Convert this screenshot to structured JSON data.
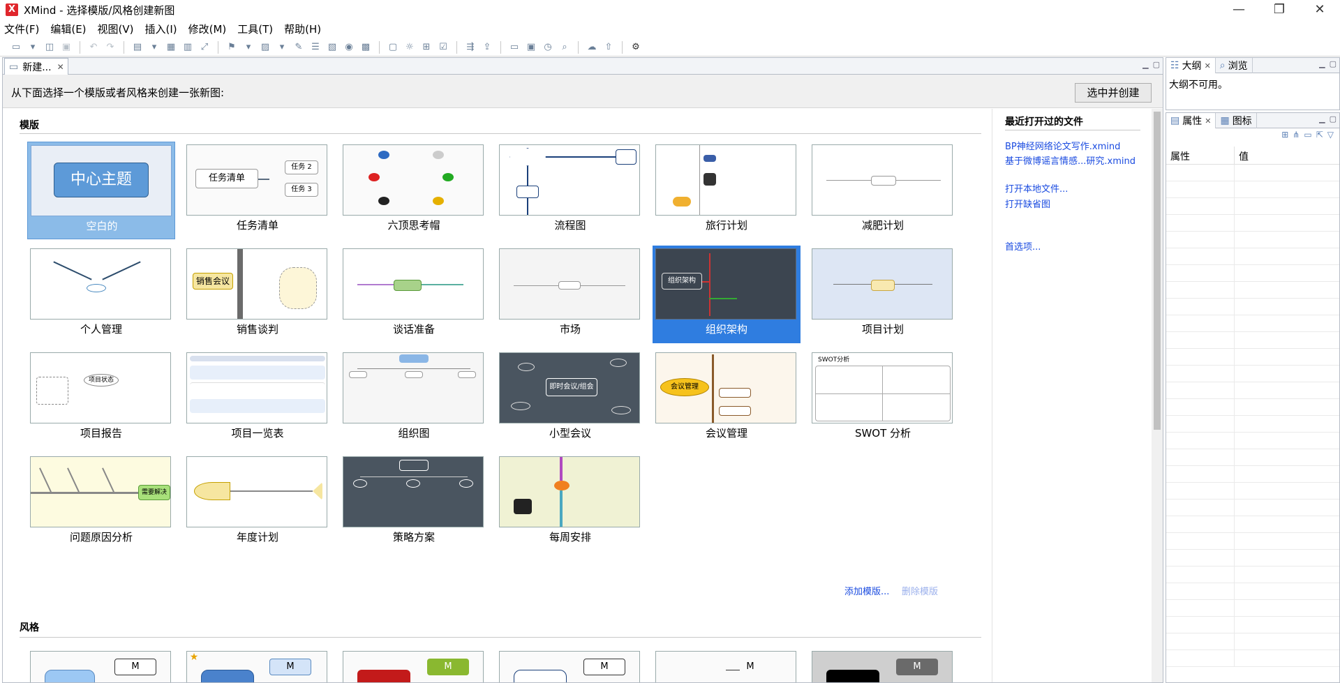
{
  "window": {
    "app_icon": "X",
    "title": "XMind - 选择模版/风格创建新图",
    "minimize": "—",
    "maximize": "❐",
    "close": "✕"
  },
  "menu": [
    "文件(F)",
    "编辑(E)",
    "视图(V)",
    "插入(I)",
    "修改(M)",
    "工具(T)",
    "帮助(H)"
  ],
  "toolbar_icons": [
    "new-map-icon",
    "dropdown-icon",
    "open-icon",
    "save-icon",
    "undo-icon",
    "redo-icon",
    "insert-topic-icon",
    "dropdown-icon",
    "subtopic-icon",
    "detach-icon",
    "relationship-icon",
    "marker-icon",
    "dropdown-icon",
    "image-icon",
    "dropdown-icon",
    "attachment-icon",
    "summary-icon",
    "label-icon",
    "note-icon",
    "boundary-icon",
    "lightbulb-icon",
    "dropdown-icon",
    "presentation-icon",
    "task-icon",
    "filter-icon",
    "share-icon",
    "export-icon",
    "layout-icon",
    "theme-icon",
    "style-icon",
    "search-icon",
    "upload-icon",
    "cloud-icon",
    "settings-icon"
  ],
  "editor": {
    "tab_label": "新建...",
    "tab_close": "✕",
    "prompt": "从下面选择一个模版或者风格来创建一张新图:",
    "create_button": "选中并创建"
  },
  "templates_section": {
    "title": "模版",
    "items": [
      {
        "label": "空白的",
        "selected": true,
        "thumb_text": "中心主题"
      },
      {
        "label": "任务清单",
        "thumb_text": "任务清单"
      },
      {
        "label": "六顶思考帽"
      },
      {
        "label": "流程图"
      },
      {
        "label": "旅行计划"
      },
      {
        "label": "减肥计划"
      },
      {
        "label": "个人管理"
      },
      {
        "label": "销售谈判",
        "thumb_text": "销售会议"
      },
      {
        "label": "谈话准备"
      },
      {
        "label": "市场"
      },
      {
        "label": "组织架构",
        "selected": true,
        "thumb_text": "组织架构"
      },
      {
        "label": "项目计划"
      },
      {
        "label": "项目报告",
        "thumb_text": "项目状态"
      },
      {
        "label": "项目一览表"
      },
      {
        "label": "组织图"
      },
      {
        "label": "小型会议",
        "thumb_text": "即时会议/组会"
      },
      {
        "label": "会议管理",
        "thumb_text": "会议管理"
      },
      {
        "label": "SWOT 分析",
        "thumb_text": "SWOT分析"
      },
      {
        "label": "问题原因分析",
        "thumb_text": "需要解决"
      },
      {
        "label": "年度计划"
      },
      {
        "label": "策略方案"
      },
      {
        "label": "每周安排"
      }
    ],
    "add_template": "添加模版...",
    "delete_template": "删除模版"
  },
  "styles_section": {
    "title": "风格",
    "thumb_letter": "M"
  },
  "recent": {
    "title": "最近打开过的文件",
    "files": [
      "BP神经网络论文写作.xmind",
      "基于微博谣言情感...研究.xmind"
    ],
    "open_local": "打开本地文件...",
    "open_default": "打开缺省图",
    "preferences": "首选项..."
  },
  "outline_panel": {
    "tabs": [
      "大纲",
      "浏览"
    ],
    "message": "大纲不可用。"
  },
  "properties_panel": {
    "tabs": [
      "属性",
      "图标"
    ],
    "columns": [
      "属性",
      "值"
    ]
  },
  "colors": {
    "accent": "#1a4be0",
    "selected": "#8bbbe8",
    "selected_dark": "#2f7de0"
  }
}
